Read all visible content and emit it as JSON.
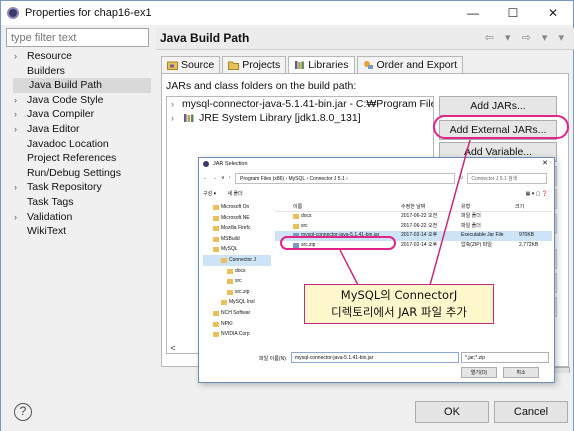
{
  "window": {
    "title": "Properties for chap16-ex1",
    "controls": [
      "—",
      "☐",
      "✕"
    ]
  },
  "filter": {
    "placeholder": "type filter text"
  },
  "tree": [
    {
      "label": "Resource",
      "expandable": true
    },
    {
      "label": "Builders",
      "expandable": false
    },
    {
      "label": "Java Build Path",
      "expandable": false,
      "selected": true
    },
    {
      "label": "Java Code Style",
      "expandable": true
    },
    {
      "label": "Java Compiler",
      "expandable": true
    },
    {
      "label": "Java Editor",
      "expandable": true
    },
    {
      "label": "Javadoc Location",
      "expandable": false
    },
    {
      "label": "Project References",
      "expandable": false
    },
    {
      "label": "Run/Debug Settings",
      "expandable": false
    },
    {
      "label": "Task Repository",
      "expandable": true
    },
    {
      "label": "Task Tags",
      "expandable": false
    },
    {
      "label": "Validation",
      "expandable": true
    },
    {
      "label": "WikiText",
      "expandable": false
    }
  ],
  "panel": {
    "title": "Java Build Path",
    "nav": "⇦ ▾ ⇨ ▾ ▾"
  },
  "tabs": [
    {
      "label": "Source",
      "active": false
    },
    {
      "label": "Projects",
      "active": false
    },
    {
      "label": "Libraries",
      "active": true
    },
    {
      "label": "Order and Export",
      "active": false
    }
  ],
  "libraries": {
    "caption": "JARs and class folders on the build path:",
    "items": [
      {
        "label": "mysql-connector-java-5.1.41-bin.jar - C:₩Program File"
      },
      {
        "label": "JRE System Library [jdk1.8.0_131]"
      }
    ]
  },
  "buttons": {
    "add_jars": "Add JARs...",
    "add_external_jars": "Add External JARs...",
    "add_variable": "Add Variable...",
    "ok": "OK",
    "cancel": "Cancel"
  },
  "jar_dialog": {
    "title": "JAR Selection",
    "path": "Program Files (x86) › MySQL › Connector J 5.1 ›",
    "search": "Connector J 5.1 검색",
    "organize": "구성 ▾",
    "new_folder": "새 폴더",
    "nav_items": [
      {
        "label": "Microsoft On",
        "level": 0
      },
      {
        "label": "Microsoft.NE",
        "level": 0
      },
      {
        "label": "Mozilla Firefc",
        "level": 0
      },
      {
        "label": "MSBuild",
        "level": 0
      },
      {
        "label": "MySQL",
        "level": 0
      },
      {
        "label": "Connector J",
        "level": 1,
        "selected": true
      },
      {
        "label": "docs",
        "level": 2
      },
      {
        "label": "src",
        "level": 2
      },
      {
        "label": "src.zip",
        "level": 2
      },
      {
        "label": "MySQL Insl",
        "level": 1
      },
      {
        "label": "NCH Softwar",
        "level": 0
      },
      {
        "label": "NPKI",
        "level": 0
      },
      {
        "label": "NVIDIA Corp",
        "level": 0
      }
    ],
    "columns": {
      "name": "이름",
      "modified": "수정한 날짜",
      "type": "유형",
      "size": "크기"
    },
    "files": [
      {
        "name": "docs",
        "modified": "2017-06-22 오전",
        "type": "파일 폴더",
        "size": "",
        "jar": false
      },
      {
        "name": "src",
        "modified": "2017-06-22 오전",
        "type": "파일 폴더",
        "size": "",
        "jar": false
      },
      {
        "name": "mysql-connector-java-5.1.41-bin.jar",
        "modified": "2017-02-14 오후",
        "type": "Executable Jar File",
        "size": "970KB",
        "jar": true,
        "selected": true
      },
      {
        "name": "src.zip",
        "modified": "2017-02-14 오후",
        "type": "압축(ZIP) 파일",
        "size": "2,772KB",
        "jar": true
      }
    ],
    "filename_label": "파일 이름(N):",
    "filename_value": "mysql-connector-java-5.1.41-bin.jar",
    "filetype_value": "*.jar;*.zip",
    "open_label": "열기(O)",
    "cancel_label": "취소"
  },
  "callout": {
    "line1": "MySQL의 ConnectorJ",
    "line2": "디렉토리에서 JAR 파일 추가"
  },
  "colors": {
    "highlight": "#e0248a",
    "callout_bg": "#fff7cc",
    "selection": "#cde4f7"
  }
}
